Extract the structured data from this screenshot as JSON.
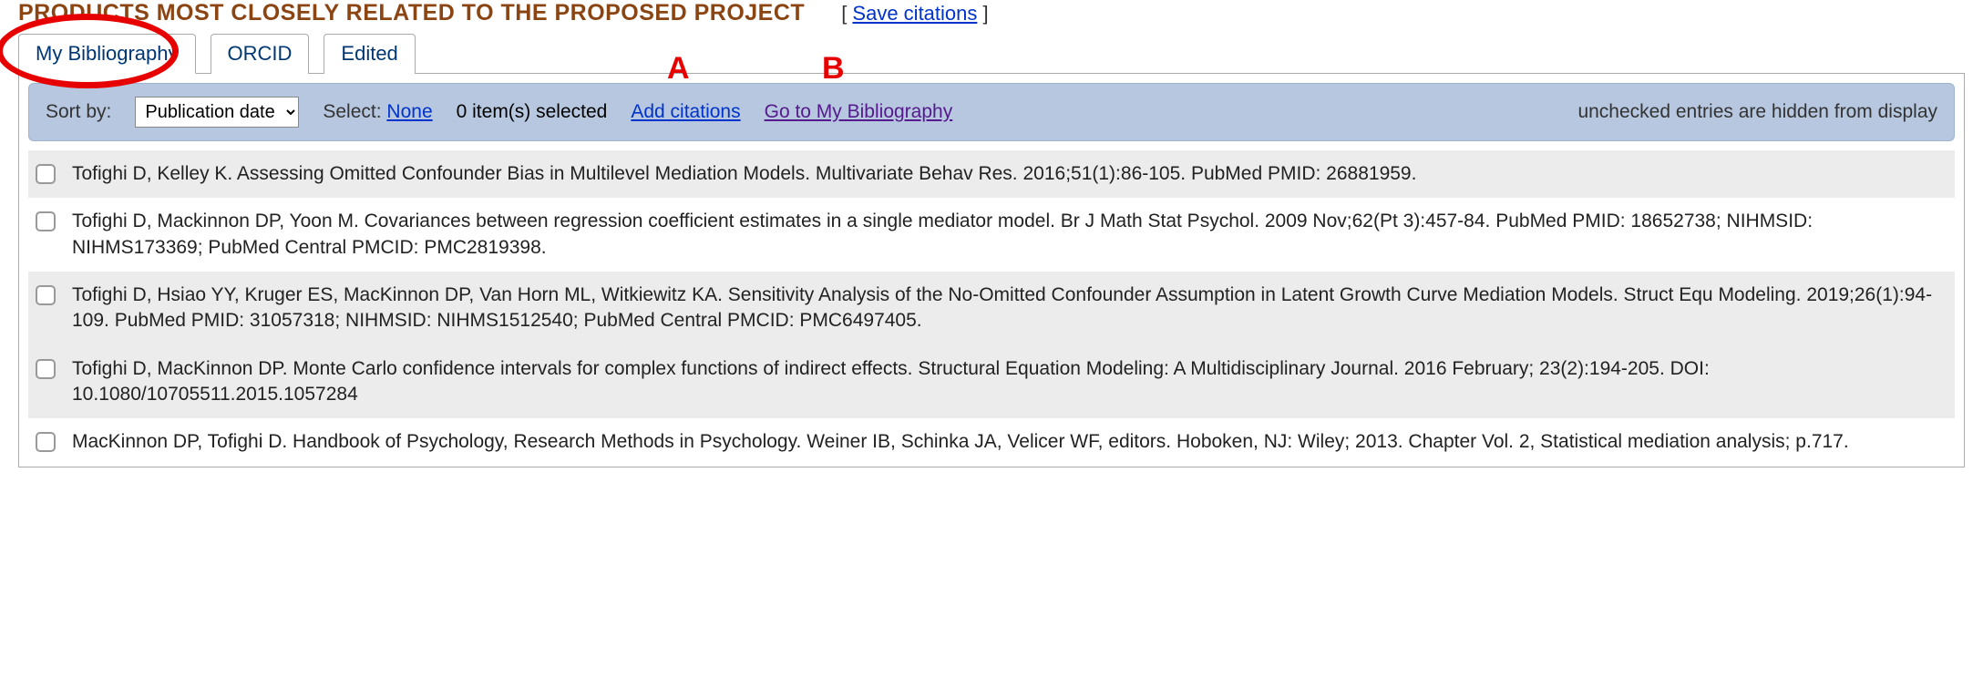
{
  "header": {
    "title": "PRODUCTS MOST CLOSELY RELATED TO THE PROPOSED PROJECT",
    "save_citations": "Save citations"
  },
  "tabs": {
    "my_bibliography": "My Bibliography",
    "orcid": "ORCID",
    "edited": "Edited"
  },
  "toolbar": {
    "sort_by_label": "Sort by:",
    "sort_by_value": "Publication date",
    "select_prefix": "Select:",
    "select_none": "None",
    "items_selected": "0 item(s) selected",
    "add_citations": "Add citations",
    "go_to_bibliography": "Go to My Bibliography",
    "hidden_note": "unchecked entries are hidden from display"
  },
  "annotations": {
    "a": "A",
    "b": "B"
  },
  "citations": [
    {
      "text": "Tofighi D, Kelley K. Assessing Omitted Confounder Bias in Multilevel Mediation Models. Multivariate Behav Res. 2016;51(1):86-105. PubMed PMID: 26881959."
    },
    {
      "text": "Tofighi D, Mackinnon DP, Yoon M. Covariances between regression coefficient estimates in a single mediator model. Br J Math Stat Psychol. 2009 Nov;62(Pt 3):457-84. PubMed PMID: 18652738; NIHMSID: NIHMS173369; PubMed Central PMCID: PMC2819398."
    },
    {
      "text": "Tofighi D, Hsiao YY, Kruger ES, MacKinnon DP, Van Horn ML, Witkiewitz KA. Sensitivity Analysis of the No-Omitted Confounder Assumption in Latent Growth Curve Mediation Models. Struct Equ Modeling. 2019;26(1):94-109. PubMed PMID: 31057318; NIHMSID: NIHMS1512540; PubMed Central PMCID: PMC6497405."
    },
    {
      "text": "Tofighi D, MacKinnon DP. Monte Carlo confidence intervals for complex functions of indirect effects. Structural Equation Modeling: A Multidisciplinary Journal. 2016 February; 23(2):194-205. DOI: 10.1080/10705511.2015.1057284"
    },
    {
      "text": "MacKinnon DP, Tofighi D. Handbook of Psychology, Research Methods in Psychology. Weiner IB, Schinka JA, Velicer WF, editors. Hoboken, NJ: Wiley; 2013. Chapter Vol. 2, Statistical mediation analysis; p.717."
    }
  ]
}
